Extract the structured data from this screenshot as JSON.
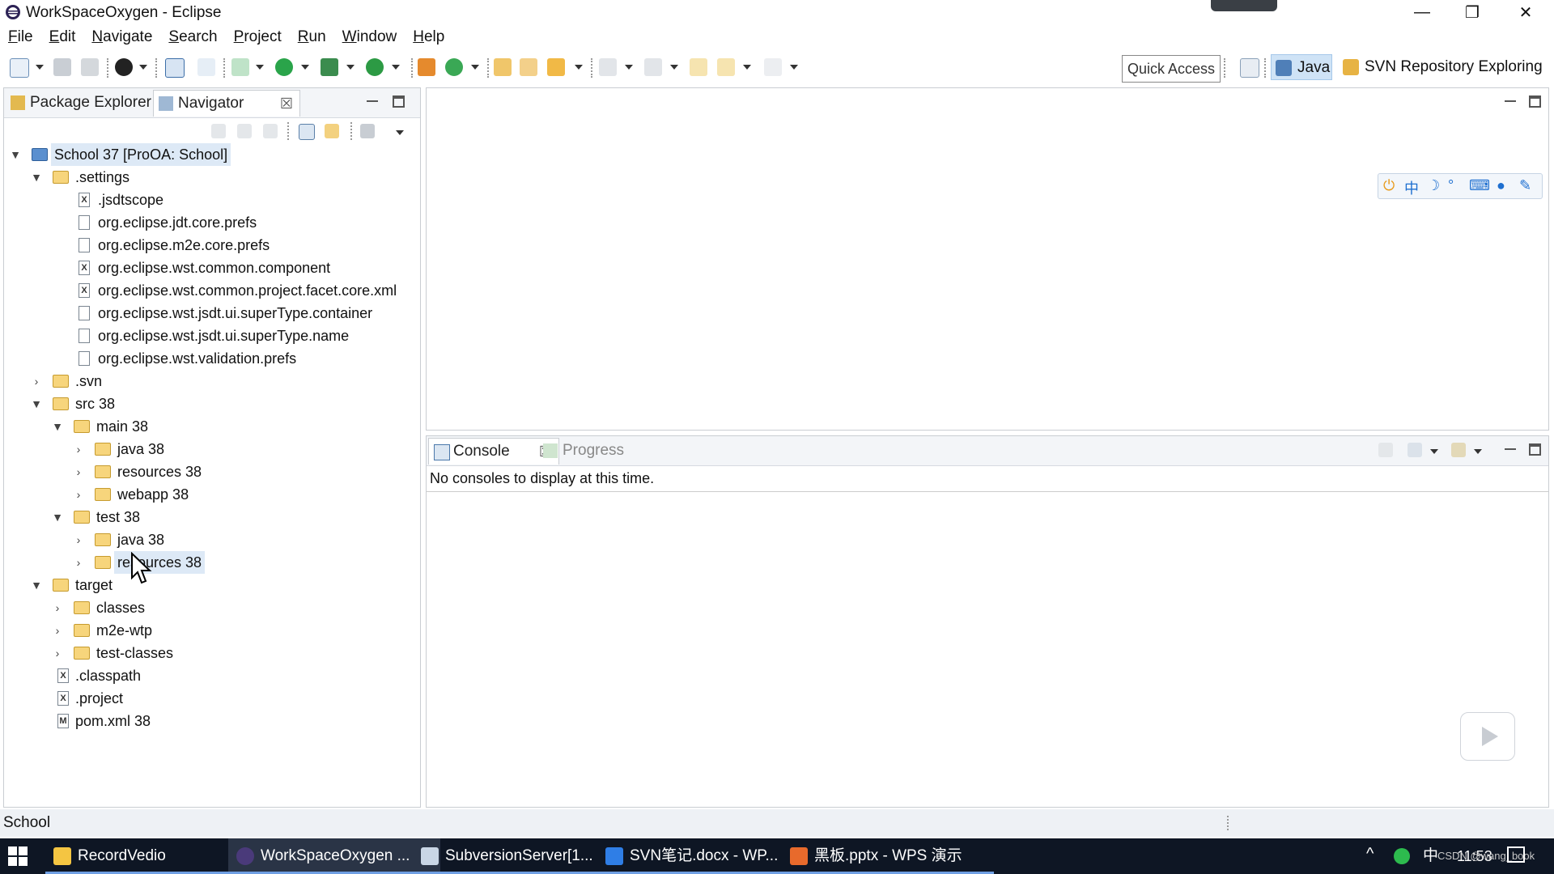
{
  "window": {
    "title": "WorkSpaceOxygen - Eclipse",
    "controls": {
      "minimize": "—",
      "restore": "❐",
      "close": "✕"
    }
  },
  "menu": [
    "File",
    "Edit",
    "Navigate",
    "Search",
    "Project",
    "Run",
    "Window",
    "Help"
  ],
  "toolbar": {
    "quick_access": "Quick Access",
    "perspectives": [
      {
        "label": "Java",
        "active": true
      },
      {
        "label": "SVN Repository Exploring",
        "active": false
      }
    ]
  },
  "left_panel": {
    "tabs": [
      {
        "label": "Package Explorer",
        "active": false
      },
      {
        "label": "Navigator",
        "active": true,
        "close": "☒"
      }
    ],
    "tree": [
      {
        "label": "School 37 [ProOA: School]"
      },
      {
        "label": ".settings"
      },
      {
        "label": ".jsdtscope"
      },
      {
        "label": "org.eclipse.jdt.core.prefs"
      },
      {
        "label": "org.eclipse.m2e.core.prefs"
      },
      {
        "label": "org.eclipse.wst.common.component"
      },
      {
        "label": "org.eclipse.wst.common.project.facet.core.xml"
      },
      {
        "label": "org.eclipse.wst.jsdt.ui.superType.container"
      },
      {
        "label": "org.eclipse.wst.jsdt.ui.superType.name"
      },
      {
        "label": "org.eclipse.wst.validation.prefs"
      },
      {
        "label": ".svn"
      },
      {
        "label": "src 38"
      },
      {
        "label": "main 38"
      },
      {
        "label": "java 38"
      },
      {
        "label": "resources 38"
      },
      {
        "label": "webapp 38"
      },
      {
        "label": "test 38"
      },
      {
        "label": "java 38"
      },
      {
        "label": "resources 38"
      },
      {
        "label": "target"
      },
      {
        "label": "classes"
      },
      {
        "label": "m2e-wtp"
      },
      {
        "label": "test-classes"
      },
      {
        "label": ".classpath"
      },
      {
        "label": ".project"
      },
      {
        "label": "pom.xml 38"
      }
    ]
  },
  "ime_toolbar": {
    "mode": "中"
  },
  "console_panel": {
    "tabs": [
      {
        "label": "Console",
        "active": true,
        "close": "☒"
      },
      {
        "label": "Progress",
        "active": false
      }
    ],
    "message": "No consoles to display at this time."
  },
  "statusbar": {
    "text": "School"
  },
  "taskbar": {
    "items": [
      {
        "label": "RecordVedio",
        "active": false
      },
      {
        "label": "WorkSpaceOxygen ...",
        "active": true
      },
      {
        "label": "SubversionServer[1...",
        "active": false
      },
      {
        "label": "SVN笔记.docx - WP...",
        "active": false
      },
      {
        "label": "黑板.pptx - WPS 演示",
        "active": false
      }
    ],
    "tray": {
      "ime": "中",
      "time": "11:53",
      "watermark": "CSDN @wang_book"
    }
  },
  "colors": {
    "accent": "#cfe3f6",
    "taskbar": "#0e1624",
    "folder": "#f7d57c"
  }
}
